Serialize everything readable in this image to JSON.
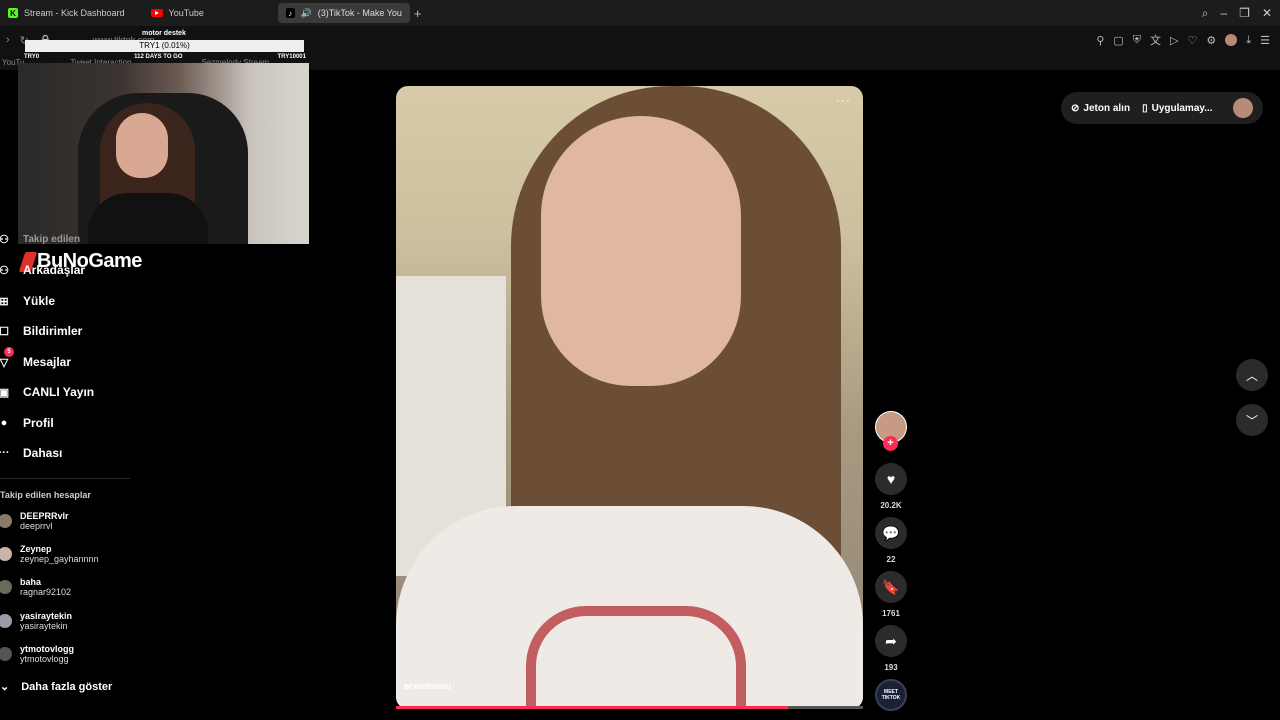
{
  "tabs": [
    {
      "label": "Stream - Kick Dashboard",
      "icon": "kick-icon"
    },
    {
      "label": "YouTube",
      "icon": "youtube-icon"
    },
    {
      "label": "(3)TikTok - Make You",
      "icon": "tiktok-icon"
    }
  ],
  "address": {
    "url": "www.tiktok.com"
  },
  "bookmarks": [
    "YouTu",
    "Tweet Interaction",
    "Sezmelody Stream"
  ],
  "overlay": {
    "title": "motor destek",
    "goal": "TRY1 (0.01%)",
    "left": "TRY0",
    "days": "112 DAYS TO GO",
    "right": "TRY10001",
    "brand": "BuNoGame"
  },
  "sidebar": {
    "partial_label": "Takip edilen",
    "items": [
      {
        "label": "Arkadaşlar",
        "icon": "friends-icon"
      },
      {
        "label": "Yükle",
        "icon": "upload-icon"
      },
      {
        "label": "Bildirimler",
        "icon": "notifications-icon"
      },
      {
        "label": "Mesajlar",
        "icon": "messages-icon",
        "badge": "5"
      },
      {
        "label": "CANLI Yayın",
        "icon": "live-icon"
      },
      {
        "label": "Profil",
        "icon": "profile-icon"
      },
      {
        "label": "Dahası",
        "icon": "more-icon"
      }
    ],
    "following_title": "Takip edilen hesaplar",
    "accounts": [
      {
        "name": "DEEPRRvlr",
        "handle": "deeprrvl"
      },
      {
        "name": "Zeynep",
        "handle": "zeynep_gayhannnn"
      },
      {
        "name": "baha",
        "handle": "ragnar92102"
      },
      {
        "name": "yasiraytekin",
        "handle": "yasiraytekin"
      },
      {
        "name": "ytmotovlogg",
        "handle": "ytmotovlogg"
      }
    ],
    "show_more": "Daha fazla göster"
  },
  "video": {
    "username": "ecemisuuu",
    "progress_percent": 84,
    "more_glyph": "···"
  },
  "actions": {
    "plus": "+",
    "likes": "20.2K",
    "comments": "22",
    "saves": "1761",
    "shares": "193",
    "music": "MEET TIKTOK"
  },
  "topright": {
    "coins": "Jeton alın",
    "app": "Uygulamay..."
  }
}
